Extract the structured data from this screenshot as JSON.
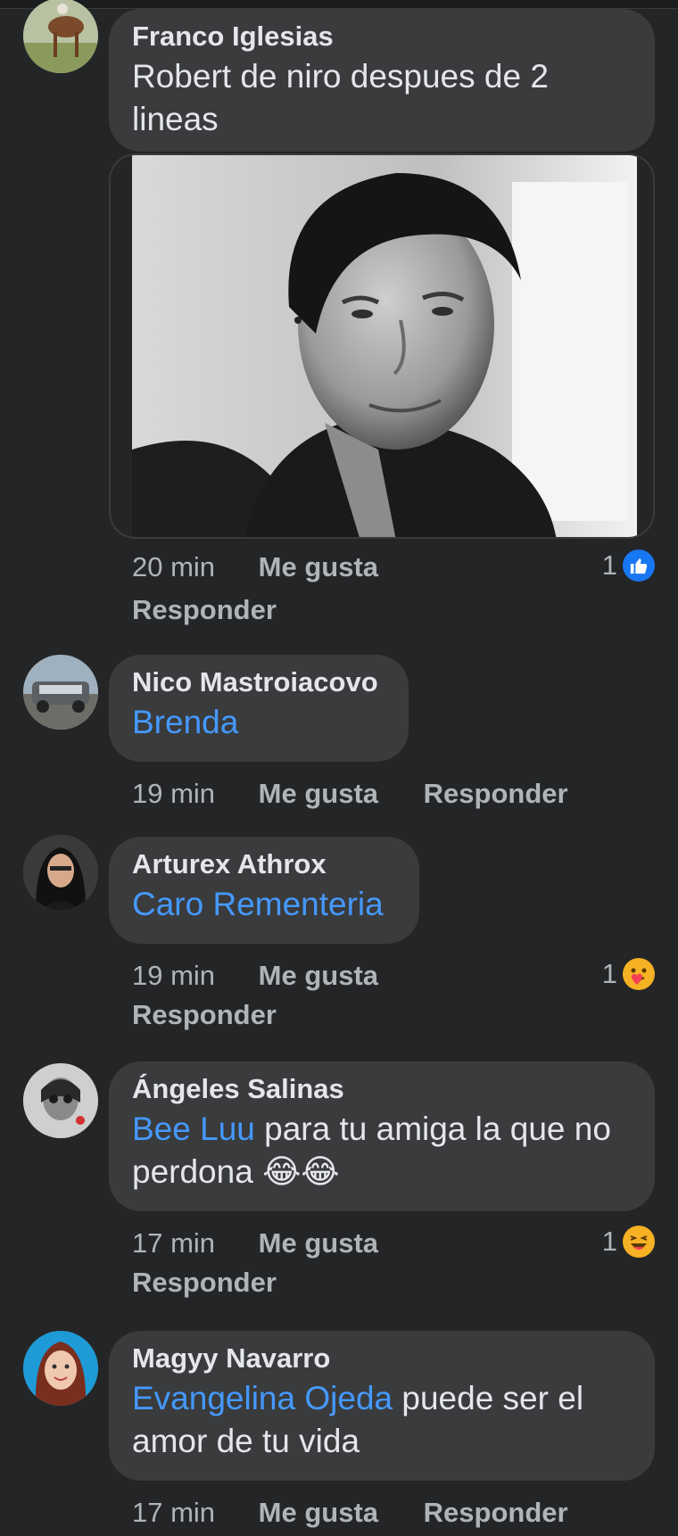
{
  "comments": [
    {
      "author": "Franco Iglesias",
      "text": "Robert de niro despues de 2 lineas",
      "time": "20 min",
      "like_label": "Me gusta",
      "reply_label": "Responder",
      "reaction_count": "1",
      "reaction_icon": "like-thumb-icon"
    },
    {
      "author": "Nico Mastroiacovo",
      "mention": "Brenda",
      "time": "19 min",
      "like_label": "Me gusta",
      "reply_label": "Responder"
    },
    {
      "author": "Arturex Athrox",
      "mention": "Caro Rementeria",
      "time": "19 min",
      "like_label": "Me gusta",
      "reply_label": "Responder",
      "reaction_count": "1",
      "reaction_icon": "care-emoji-icon"
    },
    {
      "author": "Ángeles Salinas",
      "mention": "Bee Luu",
      "text": " para tu amiga la que no perdona 😂😂",
      "time": "17 min",
      "like_label": "Me gusta",
      "reply_label": "Responder",
      "reaction_count": "1",
      "reaction_icon": "haha-emoji-icon"
    },
    {
      "author": "Magyy Navarro",
      "mention": "Evangelina Ojeda",
      "text": " puede ser el amor de tu vida",
      "time": "17 min",
      "like_label": "Me gusta",
      "reply_label": "Responder"
    }
  ],
  "colors": {
    "background": "#242526",
    "bubble": "#3a3b3c",
    "mention": "#4599ff",
    "like_blue": "#1877f2"
  }
}
